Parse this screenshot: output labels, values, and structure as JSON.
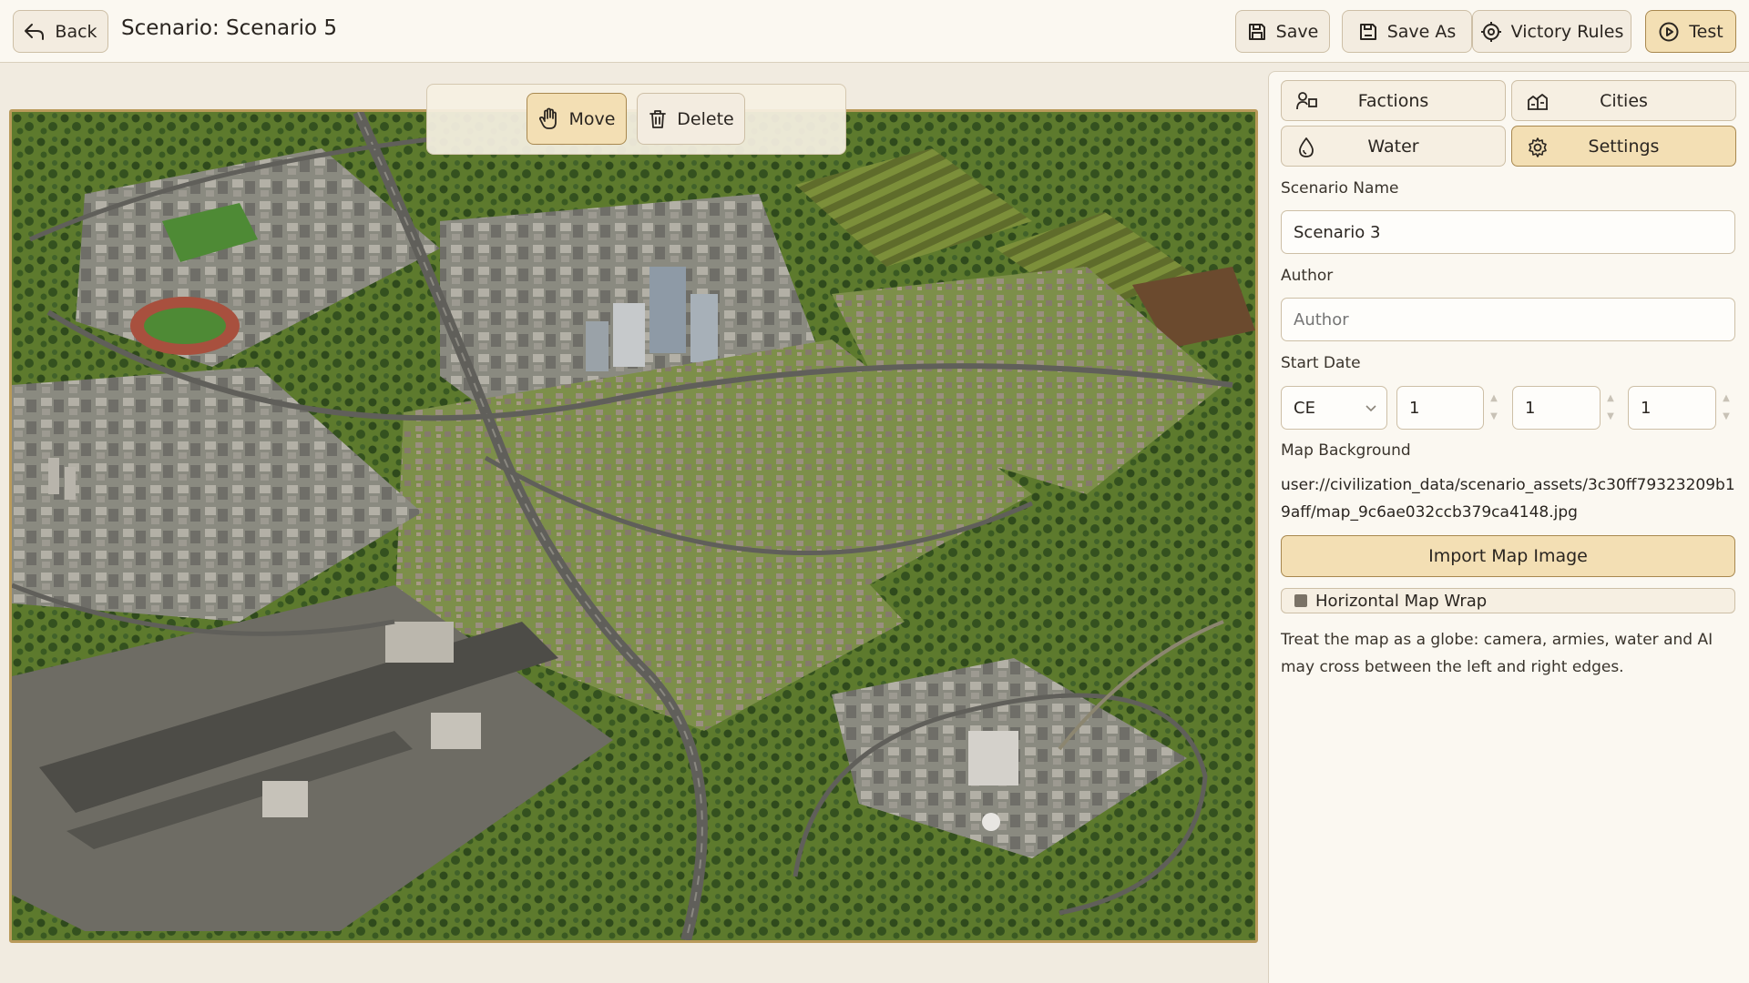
{
  "header": {
    "back_label": "Back",
    "title": "Scenario: Scenario 5",
    "save_label": "Save",
    "save_as_label": "Save As",
    "victory_rules_label": "Victory Rules",
    "test_label": "Test"
  },
  "map_toolbar": {
    "move_label": "Move",
    "delete_label": "Delete",
    "active_tool": "move"
  },
  "panel": {
    "tabs": [
      {
        "label": "Factions",
        "icon": "factions-icon"
      },
      {
        "label": "Cities",
        "icon": "cities-icon"
      },
      {
        "label": "Water",
        "icon": "water-drop-icon"
      },
      {
        "label": "Settings",
        "icon": "gear-icon"
      }
    ],
    "active_tab": "Settings",
    "scenario_name_label": "Scenario Name",
    "scenario_name_value": "Scenario 3",
    "author_label": "Author",
    "author_placeholder": "Author",
    "start_date_label": "Start Date",
    "era_value": "CE",
    "date_values": [
      "1",
      "1",
      "1"
    ],
    "map_background_label": "Map Background",
    "map_background_path": "user://civilization_data/scenario_assets/3c30ff79323209b19aff/map_9c6ae032ccb379ca4148.jpg",
    "import_button_label": "Import Map Image",
    "horizontal_wrap_label": "Horizontal Map Wrap",
    "horizontal_wrap_checked": false,
    "horizontal_wrap_description": "Treat the map as a globe: camera, armies, water and AI may cross between the left and right edges."
  },
  "colors": {
    "accent": "#f3dfb4",
    "accent_border": "#a8884f",
    "background": "#f1ebe0",
    "panel": "#fbf8f1"
  }
}
